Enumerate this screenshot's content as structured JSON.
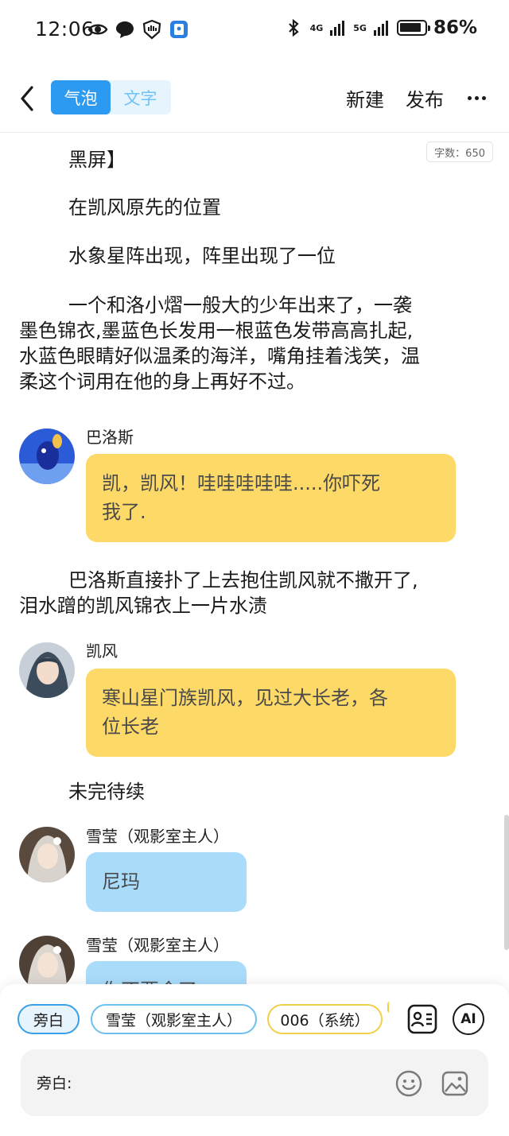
{
  "status_bar": {
    "time": "12:06",
    "network_1": "4G",
    "network_2": "5G",
    "battery": "86%"
  },
  "nav": {
    "mode_bubble": "气泡",
    "mode_text": "文字",
    "new_label": "新建",
    "publish_label": "发布"
  },
  "word_count": "字数：650",
  "story": {
    "p1": "黑屏】",
    "p2": "在凯风原先的位置",
    "p3": "水象星阵出现，阵里出现了一位",
    "p4_line1": "一个和洛小熠一般大的少年出来了，一袭",
    "p4_line2": "墨色锦衣,墨蓝色长发用一根蓝色发带高高扎起,",
    "p4_line3": "水蓝色眼睛好似温柔的海洋，嘴角挂着浅笑，温",
    "p4_line4": "柔这个词用在他的身上再好不过。",
    "p5_line1": "巴洛斯直接扑了上去抱住凯风就不撒开了,",
    "p5_line2": "泪水蹭的凯风锦衣上一片水渍",
    "p6": "未完待续"
  },
  "messages": [
    {
      "speaker": "巴洛斯",
      "line1": "凯，凯风！哇哇哇哇哇.....你吓死",
      "line2": "我了."
    },
    {
      "speaker": "凯风",
      "line1": "寒山星门族凯风，见过大长老，各",
      "line2": "位长老"
    },
    {
      "speaker": "雪莹（观影室主人）",
      "line1": "尼玛"
    },
    {
      "speaker": "雪莹（观影室主人）",
      "line1": "你不要命了"
    }
  ],
  "composer": {
    "chip_narration": "旁白",
    "chip_xueying": "雪莹（观影室主人）",
    "chip_system": "006（系统）",
    "ai_label": "AI",
    "input_label": "旁白:"
  },
  "colors": {
    "accent": "#2b9af0",
    "bubble_yellow": "#fdd967",
    "bubble_blue": "#a9dcfb"
  }
}
